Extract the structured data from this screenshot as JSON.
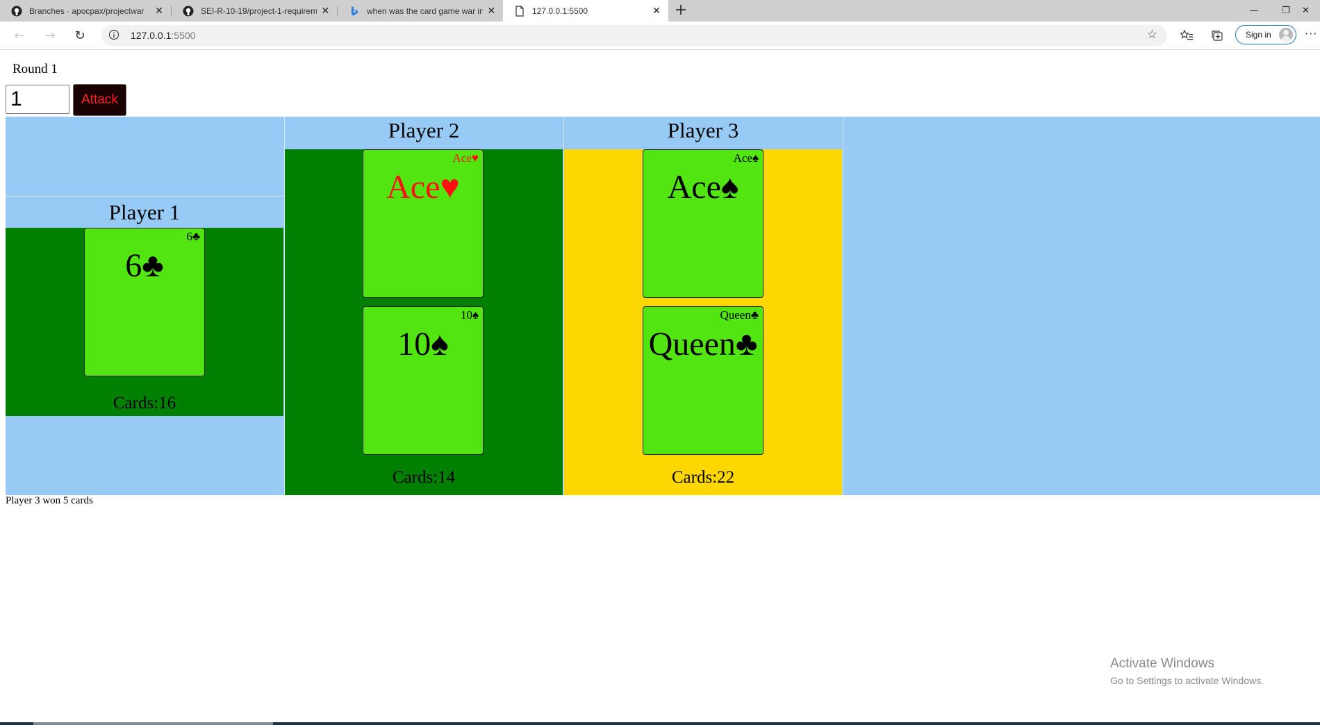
{
  "browser": {
    "tabs": [
      {
        "title": "Branches · apocpax/projectwar",
        "icon": "github-icon"
      },
      {
        "title": "SEI-R-10-19/project-1-requireme",
        "icon": "github-icon"
      },
      {
        "title": "when was the card game war inv",
        "icon": "bing-icon"
      },
      {
        "title": "127.0.0.1:5500",
        "icon": "page-icon"
      }
    ],
    "url_host": "127.0.0.1",
    "url_port": ":5500",
    "sign_in_label": "Sign in"
  },
  "page": {
    "round_label": "Round 1",
    "attack_input_value": "1",
    "attack_button_label": "Attack",
    "players": [
      {
        "name": "Player 1",
        "cards_label": "Cards:16",
        "hand_color": "#007f00",
        "cards": [
          {
            "rank": "6",
            "suit": "♣",
            "color": "black"
          }
        ]
      },
      {
        "name": "Player 2",
        "cards_label": "Cards:14",
        "hand_color": "#007f00",
        "cards": [
          {
            "rank": "Ace",
            "suit": "♥",
            "color": "red"
          },
          {
            "rank": "10",
            "suit": "♠",
            "color": "black"
          }
        ]
      },
      {
        "name": "Player 3",
        "cards_label": "Cards:22",
        "hand_color": "#ffd700",
        "cards": [
          {
            "rank": "Ace",
            "suit": "♠",
            "color": "black"
          },
          {
            "rank": "Queen",
            "suit": "♣",
            "color": "black"
          }
        ]
      }
    ],
    "result_text": "Player 3 won 5 cards"
  },
  "os": {
    "watermark_title": "Activate Windows",
    "watermark_subtitle": "Go to Settings to activate Windows."
  }
}
